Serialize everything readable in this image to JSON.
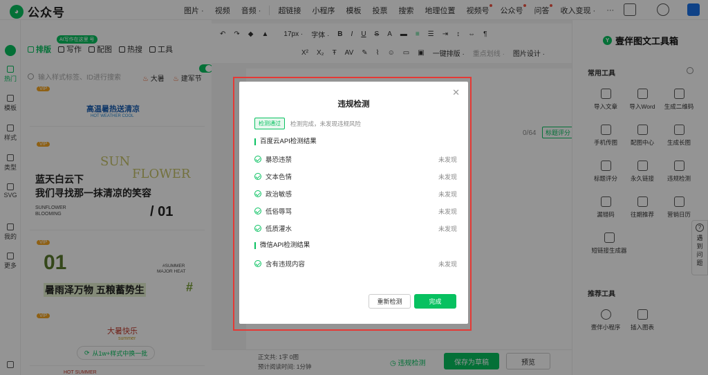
{
  "app": {
    "name": "公众号"
  },
  "topmenu": {
    "group1": [
      "图片 ·",
      "视频",
      "音频 ·"
    ],
    "group2": [
      "超链接",
      "小程序",
      "模板",
      "投票",
      "搜索",
      "地理位置",
      "视频号",
      "公众号",
      "问答",
      "收入变现 ·",
      "···"
    ]
  },
  "leftnav": [
    {
      "label": "热门",
      "active": true
    },
    {
      "label": "模板"
    },
    {
      "label": "样式"
    },
    {
      "label": "类型"
    },
    {
      "label": "SVG"
    },
    {
      "label": "我的"
    },
    {
      "label": "更多"
    }
  ],
  "tplpanel": {
    "ai_badge": "AI写作在这里 号",
    "tabs": [
      "排版",
      "写作",
      "配图",
      "热搜",
      "工具"
    ],
    "search_placeholder": "输入样式标签、ID进行搜索",
    "hot_tags": [
      "大暑",
      "建军节"
    ],
    "vip_label": "VIP",
    "card1_title": "高温暑热送清凉",
    "card1_sub": "HOT WEATHER COOL",
    "card2_sun": "SUN",
    "card2_flower": "FLOWER",
    "card2_line1": "蓝天白云下",
    "card2_line2": "我们寻找那一抹清凉的笑容",
    "card2_en1": "SUNFLOWER",
    "card2_en2": "BLOOMING",
    "card2_num": "/ 01",
    "card3_num": "01",
    "card3_tag1": "#SUMMER",
    "card3_tag2": "MAJOR HEAT",
    "card3_title": "暑雨泽万物 五粮蓄势生",
    "card3_hash": "#",
    "card4_title": "大暑快乐",
    "card4_sub": "summer",
    "card5_text": "HOT SUMMER",
    "swap_button": "从1w+样式中换一批"
  },
  "toolbar": {
    "font_size": "17px ·",
    "font_label": "字体 ·",
    "one_click": "一键排版 ·",
    "layout_label": "重点划线 ·",
    "image_design": "图片设计 ·"
  },
  "editor": {
    "counter": "0/64",
    "title_score": "标题评分",
    "stats_line1": "正文共: 1字 0图",
    "stats_line2": "预计阅读时间: 1分钟",
    "check_button": "违规检测",
    "save_button": "保存为草稿",
    "preview_button": "预览"
  },
  "rightpanel": {
    "title": "壹伴图文工具箱",
    "common_title": "常用工具",
    "tools": [
      {
        "label": "导入文章"
      },
      {
        "label": "导入Word"
      },
      {
        "label": "生成二维码"
      },
      {
        "label": "手机传图"
      },
      {
        "label": "配图中心"
      },
      {
        "label": "生成长图"
      },
      {
        "label": "标题评分"
      },
      {
        "label": "永久链接"
      },
      {
        "label": "违规检测"
      },
      {
        "label": "漏错码"
      },
      {
        "label": "往期推荐"
      },
      {
        "label": "营销日历"
      },
      {
        "label": "短链接生成器"
      }
    ],
    "recommend_title": "推荐工具",
    "recommend": [
      {
        "label": "壹伴小程序"
      },
      {
        "label": "插入图表"
      }
    ],
    "help": "遇到问题"
  },
  "modal": {
    "title": "违规检测",
    "pass_tag": "检测通过",
    "pass_msg": "检测完成，未发现违规风险",
    "section1": "百度云API检测结果",
    "items1": [
      {
        "label": "暴恐违禁",
        "result": "未发现"
      },
      {
        "label": "文本色情",
        "result": "未发现"
      },
      {
        "label": "政治敏感",
        "result": "未发现"
      },
      {
        "label": "低俗辱骂",
        "result": "未发现"
      },
      {
        "label": "低质灌水",
        "result": "未发现"
      }
    ],
    "section2": "微信API检测结果",
    "items2": [
      {
        "label": "含有违规内容",
        "result": "未发现"
      }
    ],
    "retry_button": "重新检测",
    "done_button": "完成"
  },
  "colors": {
    "accent": "#07c160",
    "highlight_frame": "#e53935"
  }
}
